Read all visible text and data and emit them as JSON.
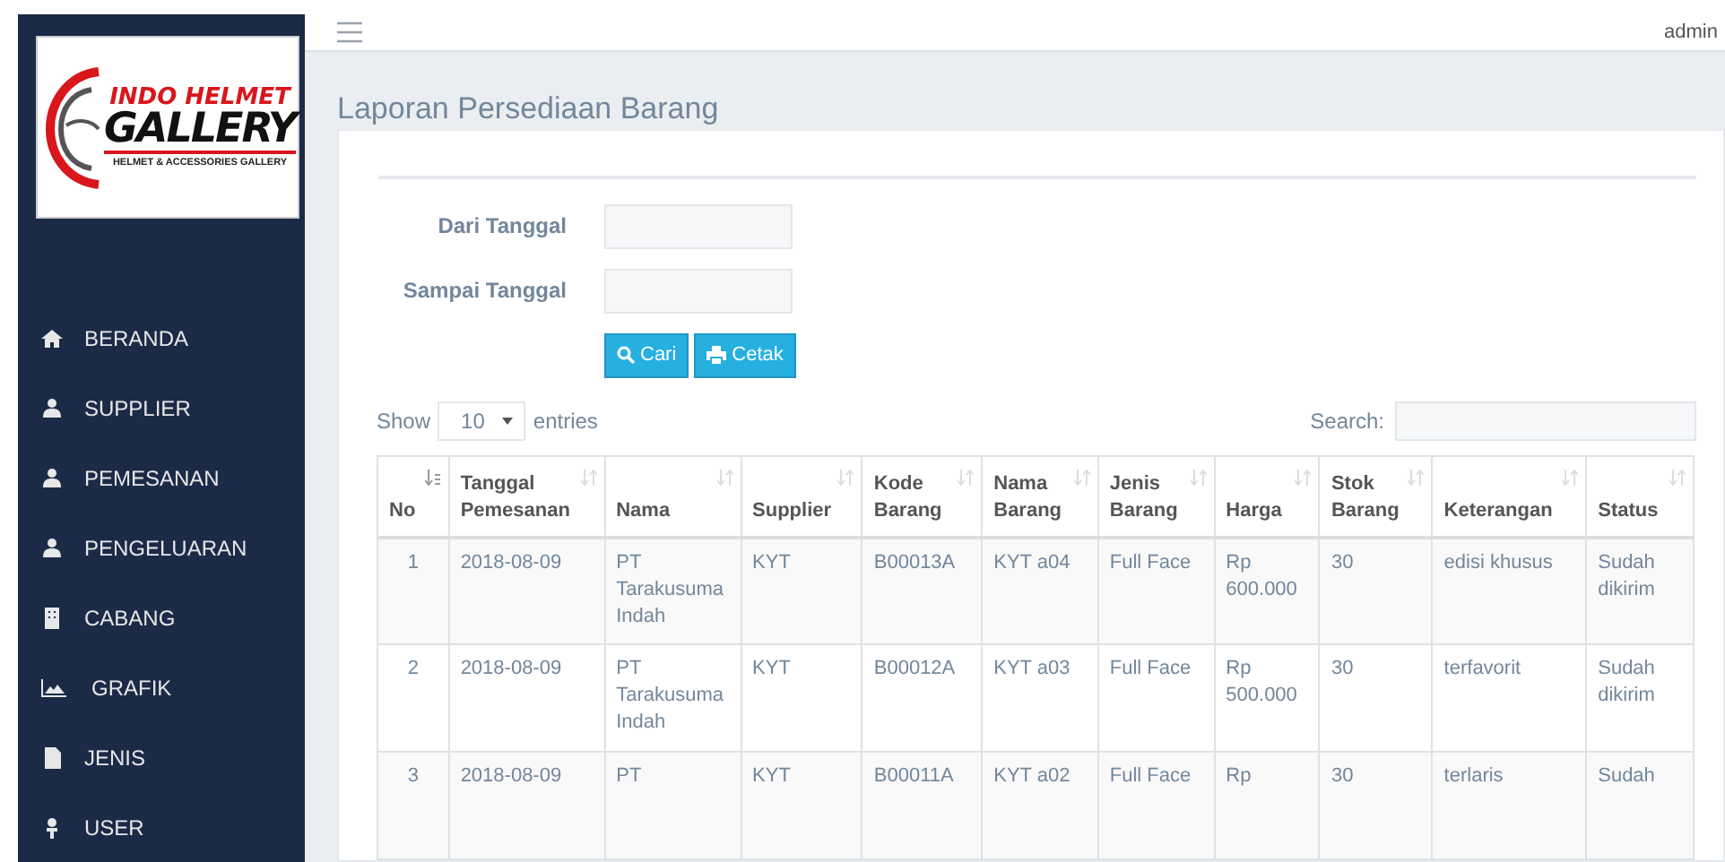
{
  "logo": {
    "line_1": "INDO HELMET",
    "line_2": "GALLERY",
    "tagline": "HELMET & ACCESSORIES GALLERY"
  },
  "sidebar": {
    "items": [
      {
        "label": "BERANDA",
        "selected": false
      },
      {
        "label": "SUPPLIER",
        "selected": false
      },
      {
        "label": "PEMESANAN",
        "selected": false
      },
      {
        "label": "PENGELUARAN",
        "selected": false
      },
      {
        "label": "CABANG",
        "selected": false
      },
      {
        "label": "GRAFIK",
        "selected": false
      },
      {
        "label": "JENIS",
        "selected": false
      },
      {
        "label": "USER",
        "selected": false
      }
    ]
  },
  "topbar": {
    "user": "admin"
  },
  "page_title": "Laporan Persediaan Barang",
  "filter": {
    "fields": [
      {
        "label": "Dari Tanggal"
      },
      {
        "label": "Sampai Tanggal"
      }
    ],
    "buttons": [
      {
        "kind": "search",
        "label": "Cari"
      },
      {
        "kind": "print",
        "label": "Cetak"
      }
    ]
  },
  "table_controls": {
    "show": "Show",
    "length": "10",
    "entries": "entries",
    "search": "Search:"
  },
  "table": {
    "columns": [
      {
        "label": "No",
        "sorted": true
      },
      {
        "label": "Tanggal Pemesanan",
        "sorted": false
      },
      {
        "label": "Nama",
        "sorted": false
      },
      {
        "label": "Supplier",
        "sorted": false
      },
      {
        "label": "Kode Barang",
        "sorted": false
      },
      {
        "label": "Nama Barang",
        "sorted": false
      },
      {
        "label": "Jenis Barang",
        "sorted": false
      },
      {
        "label": "Harga",
        "sorted": false
      },
      {
        "label": "Stok Barang",
        "sorted": false
      },
      {
        "label": "Keterangan",
        "sorted": false
      },
      {
        "label": "Status",
        "sorted": false
      }
    ],
    "rows": [
      [
        "1",
        "2018-08-09",
        "PT Tarakusuma Indah",
        "KYT",
        "B00013A",
        "KYT a04",
        "Full Face",
        "Rp 600.000",
        "30",
        "edisi khusus",
        "Sudah dikirim"
      ],
      [
        "2",
        "2018-08-09",
        "PT Tarakusuma Indah",
        "KYT",
        "B00012A",
        "KYT a03",
        "Full Face",
        "Rp 500.000",
        "30",
        "terfavorit",
        "Sudah dikirim"
      ],
      [
        "3",
        "2018-08-09",
        "PT",
        "KYT",
        "B00011A",
        "KYT a02",
        "Full Face",
        "Rp",
        "30",
        "terlaris",
        "Sudah"
      ]
    ]
  }
}
